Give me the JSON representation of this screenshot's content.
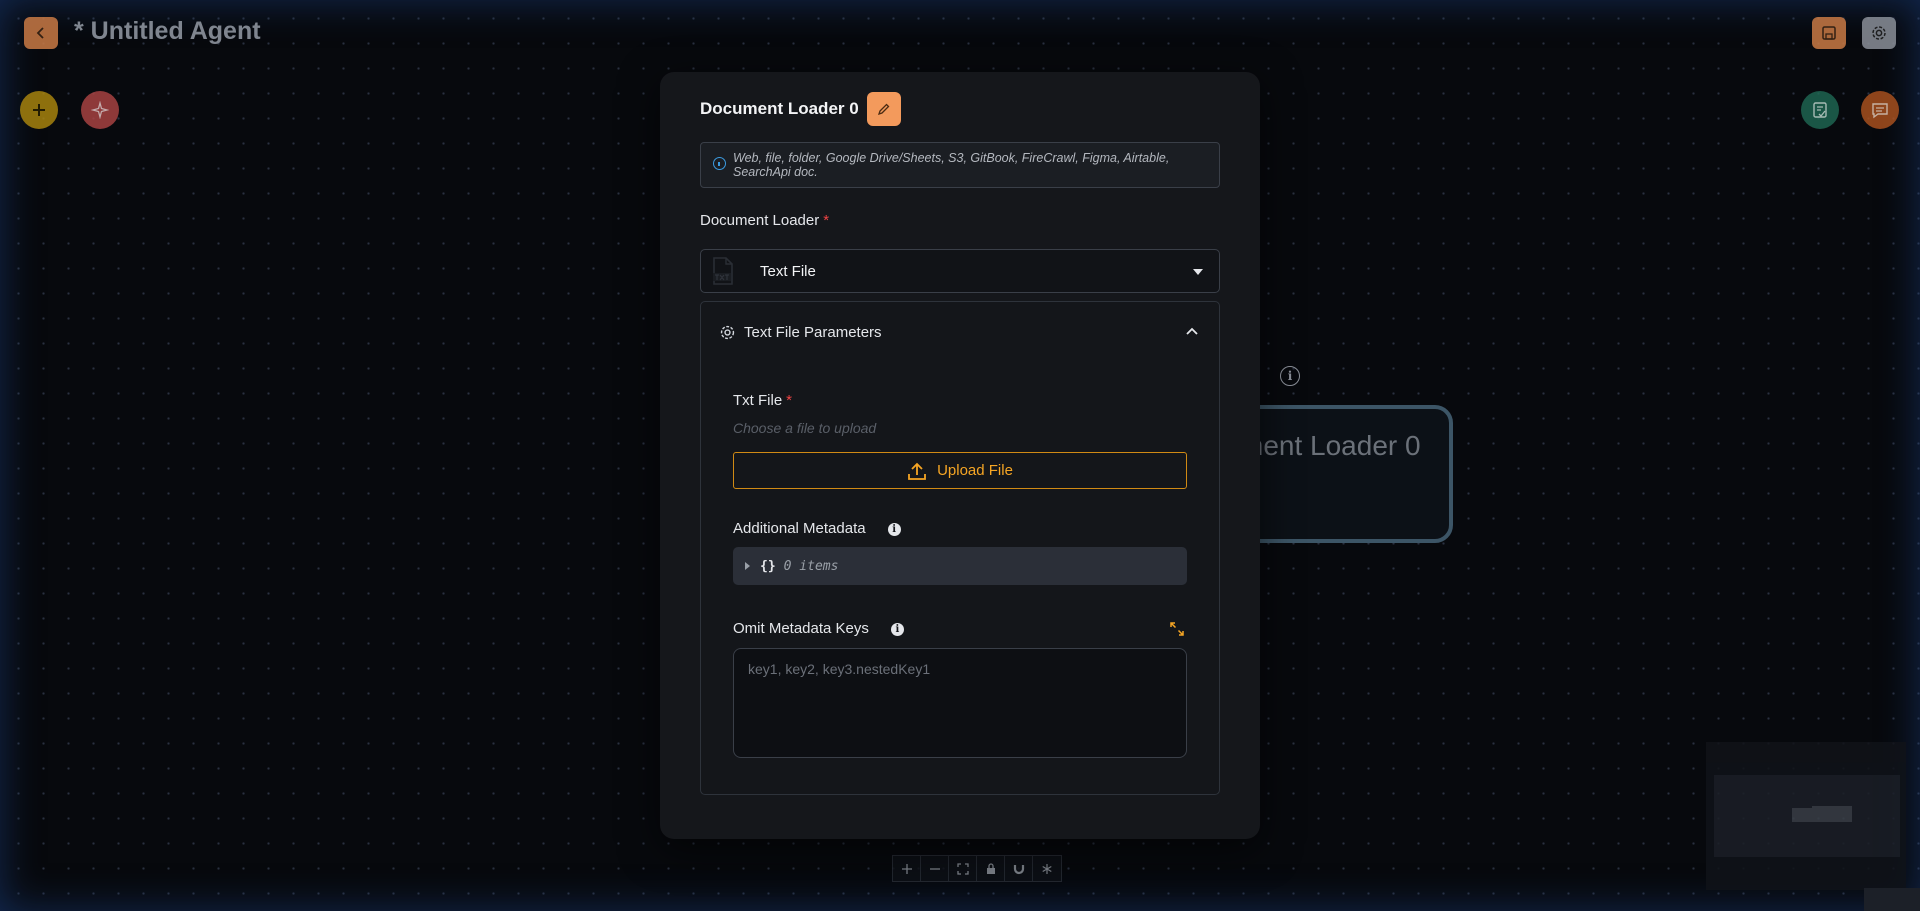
{
  "header": {
    "title": "* Untitled Agent"
  },
  "canvas": {
    "node_title": "ment Loader 0"
  },
  "modal": {
    "title": "Document Loader 0",
    "description": "Web, file, folder, Google Drive/Sheets, S3, GitBook, FireCrawl, Figma, Airtable, SearchApi doc.",
    "loader_label": "Document Loader",
    "required_mark": "*",
    "selected_loader": "Text File",
    "params_title": "Text File Parameters",
    "txt_file_label": "Txt File",
    "txt_file_placeholder": "Choose a file to upload",
    "upload_label": "Upload File",
    "metadata_label": "Additional Metadata",
    "metadata_braces": "{}",
    "metadata_count": "0 items",
    "omit_label": "Omit Metadata Keys",
    "omit_placeholder": "key1, key2, key3.nestedKey1"
  },
  "icons": {
    "back": "chevron-left-icon",
    "save": "save-icon",
    "settings": "gear-icon",
    "add": "plus-icon",
    "magic": "sparkles-icon",
    "validate": "clipboard-check-icon",
    "chat": "chat-icon"
  },
  "colors": {
    "accent": "#f5a524",
    "edit_button": "#f39a5c",
    "info": "#3b9be0",
    "required": "#ef4444"
  }
}
